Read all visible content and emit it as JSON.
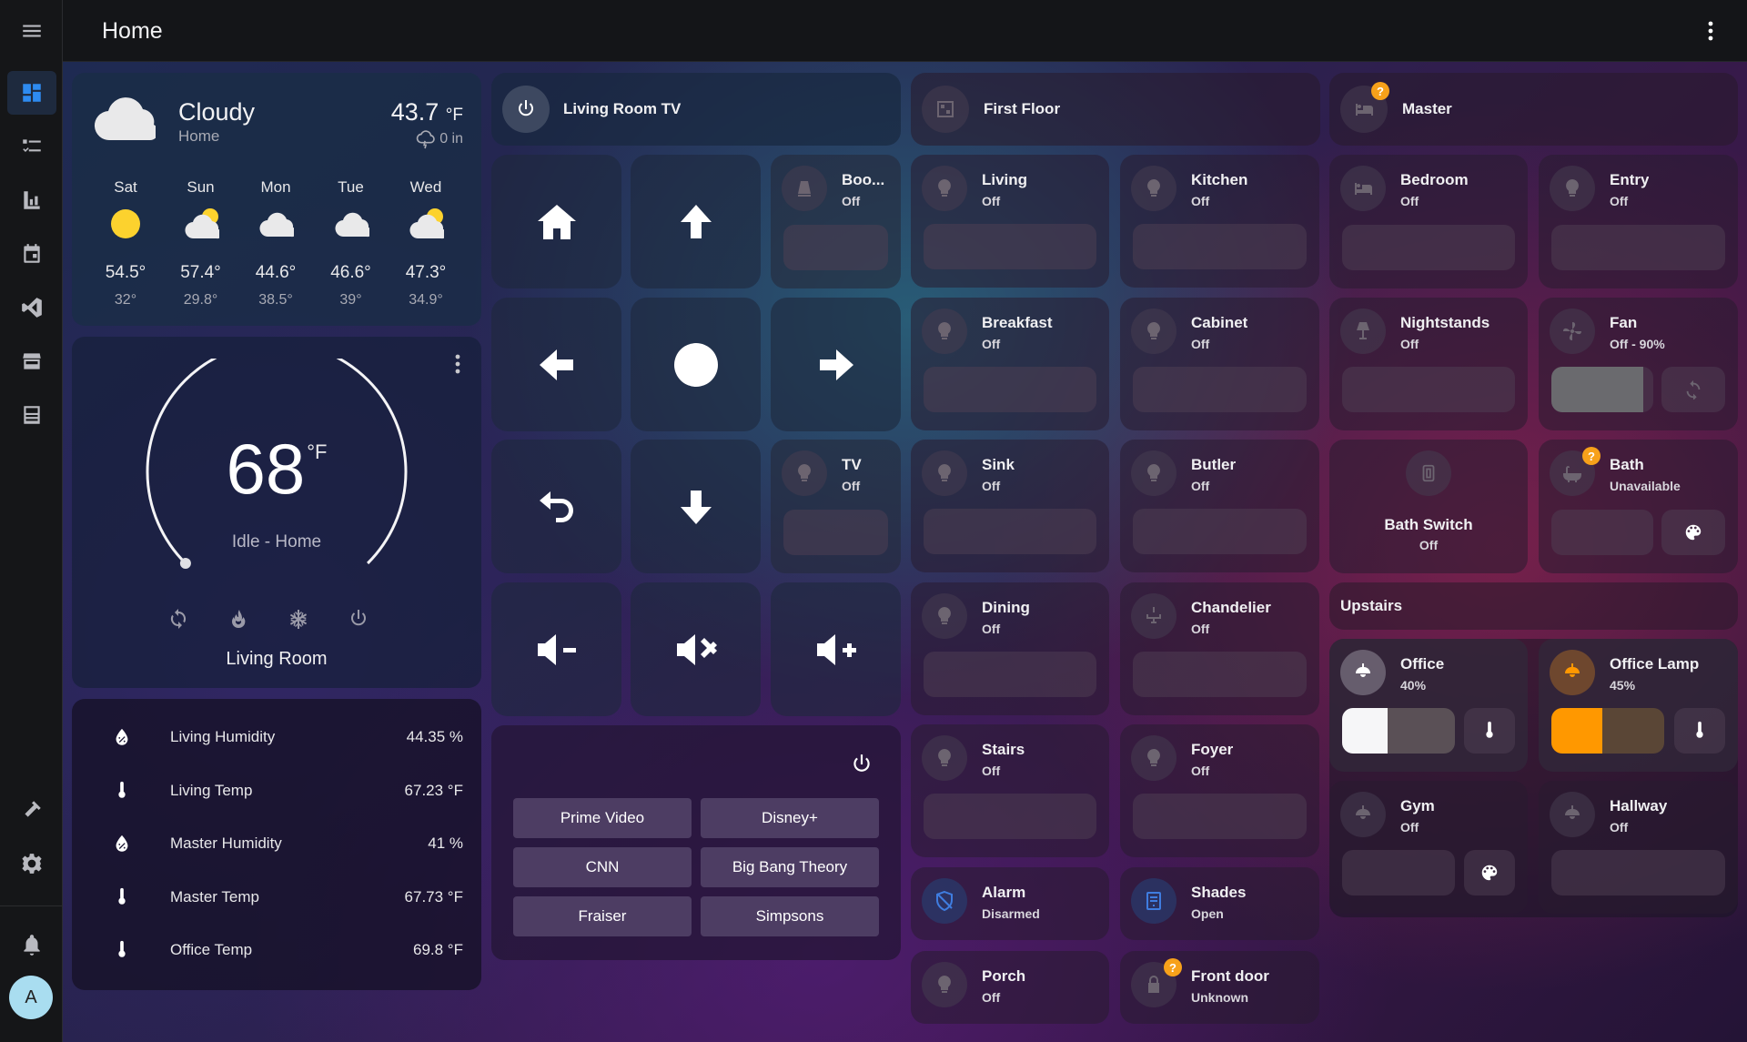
{
  "header": {
    "title": "Home"
  },
  "sidebar": {
    "avatar_letter": "A"
  },
  "weather": {
    "condition": "Cloudy",
    "location": "Home",
    "temp": "43.7",
    "temp_unit": "°F",
    "precip": "0 in",
    "forecast": [
      {
        "day": "Sat",
        "high": "54.5°",
        "low": "32°",
        "icon": "sun-icon"
      },
      {
        "day": "Sun",
        "high": "57.4°",
        "low": "29.8°",
        "icon": "partly-cloudy-icon"
      },
      {
        "day": "Mon",
        "high": "44.6°",
        "low": "38.5°",
        "icon": "cloud-icon"
      },
      {
        "day": "Tue",
        "high": "46.6°",
        "low": "39°",
        "icon": "cloud-icon"
      },
      {
        "day": "Wed",
        "high": "47.3°",
        "low": "34.9°",
        "icon": "partly-cloudy-icon"
      }
    ]
  },
  "thermostat": {
    "target": "68",
    "unit": "°F",
    "status": "Idle - Home",
    "name": "Living Room",
    "dial_fraction": 0.0
  },
  "sensors": [
    {
      "name": "Living Humidity",
      "value": "44.35 %",
      "icon": "water-percent-icon"
    },
    {
      "name": "Living Temp",
      "value": "67.23 °F",
      "icon": "thermometer-icon"
    },
    {
      "name": "Master Humidity",
      "value": "41 %",
      "icon": "water-percent-icon"
    },
    {
      "name": "Master Temp",
      "value": "67.73 °F",
      "icon": "thermometer-icon"
    },
    {
      "name": "Office Temp",
      "value": "69.8 °F",
      "icon": "thermometer-icon"
    }
  ],
  "remote": {
    "title": "Living Room TV"
  },
  "tv_side": [
    {
      "name": "Boo...",
      "state": "Off"
    },
    {
      "name": "TV",
      "state": "Off"
    }
  ],
  "apps": [
    "Prime Video",
    "Disney+",
    "CNN",
    "Big Bang Theory",
    "Fraiser",
    "Simpsons"
  ],
  "first_floor": {
    "title": "First Floor",
    "lights": [
      {
        "name": "Living",
        "state": "Off"
      },
      {
        "name": "Kitchen",
        "state": "Off"
      },
      {
        "name": "Breakfast",
        "state": "Off"
      },
      {
        "name": "Cabinet",
        "state": "Off"
      },
      {
        "name": "Sink",
        "state": "Off"
      },
      {
        "name": "Butler",
        "state": "Off"
      },
      {
        "name": "Dining",
        "state": "Off"
      },
      {
        "name": "Chandelier",
        "state": "Off"
      },
      {
        "name": "Stairs",
        "state": "Off"
      },
      {
        "name": "Foyer",
        "state": "Off"
      }
    ],
    "alarm": {
      "name": "Alarm",
      "state": "Disarmed"
    },
    "shades": {
      "name": "Shades",
      "state": "Open"
    },
    "porch": {
      "name": "Porch",
      "state": "Off"
    },
    "front_door": {
      "name": "Front door",
      "state": "Unknown"
    }
  },
  "master": {
    "title": "Master",
    "bedroom": {
      "name": "Bedroom",
      "state": "Off"
    },
    "entry": {
      "name": "Entry",
      "state": "Off"
    },
    "nightstands": {
      "name": "Nightstands",
      "state": "Off"
    },
    "fan": {
      "name": "Fan",
      "state": "Off - 90%",
      "level": 0.9
    },
    "bath_switch": {
      "name": "Bath Switch",
      "state": "Off"
    },
    "bath": {
      "name": "Bath",
      "state": "Unavailable"
    }
  },
  "upstairs": {
    "title": "Upstairs",
    "office": {
      "name": "Office",
      "state": "40%",
      "level": 0.4
    },
    "office_lamp": {
      "name": "Office Lamp",
      "state": "45%",
      "level": 0.45
    },
    "gym": {
      "name": "Gym",
      "state": "Off"
    },
    "hallway": {
      "name": "Hallway",
      "state": "Off"
    }
  },
  "colors": {
    "accent": "#2e8bf0",
    "warning": "#f7a11a",
    "lamp": "#ff9800"
  }
}
